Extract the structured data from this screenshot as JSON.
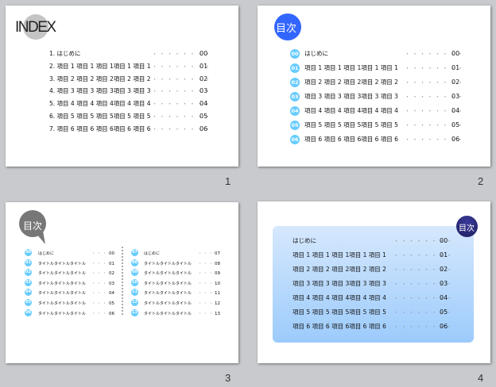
{
  "slides": [
    {
      "number": "1",
      "title": "INDEX",
      "dots": "・・・・・・・・",
      "items": [
        {
          "label": "1.  はじめに",
          "page": "00"
        },
        {
          "label": "2.  項目 1 項目 1 項目 1項目 1 項目 1",
          "page": "01"
        },
        {
          "label": "3.  項目 2 項目 2 項目 2項目 2 項目 2",
          "page": "02"
        },
        {
          "label": "4.  項目 3 項目 3 項目 3項目 3 項目 3",
          "page": "03"
        },
        {
          "label": "5.  項目 4 項目 4 項目 4項目 4 項目 4",
          "page": "04"
        },
        {
          "label": "6.  項目 5 項目 5 項目 5項目 5 項目 5",
          "page": "05"
        },
        {
          "label": "7.  項目 6 項目 6 項目 6項目 6 項目 6",
          "page": "06"
        }
      ]
    },
    {
      "number": "2",
      "title": "目次",
      "dots": "・・・・・・・・",
      "items": [
        {
          "badge": "00",
          "label": "はじめに",
          "page": "00"
        },
        {
          "badge": "01",
          "label": "項目 1 項目 1 項目 1項目 1 項目 1",
          "page": "01"
        },
        {
          "badge": "02",
          "label": "項目 2 項目 2 項目 2項目 2 項目 2",
          "page": "02"
        },
        {
          "badge": "03",
          "label": "項目 3 項目 3 項目 3項目 3 項目 3",
          "page": "03"
        },
        {
          "badge": "04",
          "label": "項目 4 項目 4 項目 4項目 4 項目 4",
          "page": "04"
        },
        {
          "badge": "05",
          "label": "項目 5 項目 5 項目 5項目 5 項目 5",
          "page": "05"
        },
        {
          "badge": "06",
          "label": "項目 6 項目 6 項目 6項目 6 項目 6",
          "page": "06"
        }
      ]
    },
    {
      "number": "3",
      "title": "目次",
      "dots": "・・・",
      "left": [
        {
          "badge": "00",
          "label": "はじめに",
          "page": "00"
        },
        {
          "badge": "01",
          "label": "タイトルタイトルタイトル",
          "page": "01"
        },
        {
          "badge": "02",
          "label": "タイトルタイトルタイトル",
          "page": "02"
        },
        {
          "badge": "03",
          "label": "タイトルタイトルタイトル",
          "page": "03"
        },
        {
          "badge": "04",
          "label": "タイトルタイトルタイトル",
          "page": "04"
        },
        {
          "badge": "05",
          "label": "タイトルタイトルタイトル",
          "page": "05"
        },
        {
          "badge": "06",
          "label": "タイトルタイトルタイトル",
          "page": "06"
        }
      ],
      "right": [
        {
          "badge": "07",
          "label": "はじめに",
          "page": "07"
        },
        {
          "badge": "08",
          "label": "タイトルタイトルタイトル",
          "page": "08"
        },
        {
          "badge": "09",
          "label": "タイトルタイトルタイトル",
          "page": "09"
        },
        {
          "badge": "10",
          "label": "タイトルタイトルタイトル",
          "page": "10"
        },
        {
          "badge": "11",
          "label": "タイトルタイトルタイトル",
          "page": "11"
        },
        {
          "badge": "12",
          "label": "タイトルタイトルタイトル",
          "page": "12"
        },
        {
          "badge": "13",
          "label": "タイトルタイトルタイトル",
          "page": "13"
        }
      ]
    },
    {
      "number": "4",
      "title": "目次",
      "dots": "・・・・・・・・",
      "items": [
        {
          "label": "はじめに",
          "page": "00"
        },
        {
          "label": "項目 1 項目 1 項目 1項目 1 項目 1",
          "page": "01"
        },
        {
          "label": "項目 2 項目 2 項目 2項目 2 項目 2",
          "page": "02"
        },
        {
          "label": "項目 3 項目 3 項目 3項目 3 項目 3",
          "page": "03"
        },
        {
          "label": "項目 4 項目 4 項目 4項目 4 項目 4",
          "page": "04"
        },
        {
          "label": "項目 5 項目 5 項目 5項目 5 項目 5",
          "page": "05"
        },
        {
          "label": "項目 6 項目 6 項目 6項目 6 項目 6",
          "page": "06"
        }
      ]
    }
  ],
  "colors": {
    "badge": "#66ccff",
    "slide2_title": "#3366ff",
    "slide3_title": "#777777",
    "slide4_title": "#2a2a78"
  }
}
